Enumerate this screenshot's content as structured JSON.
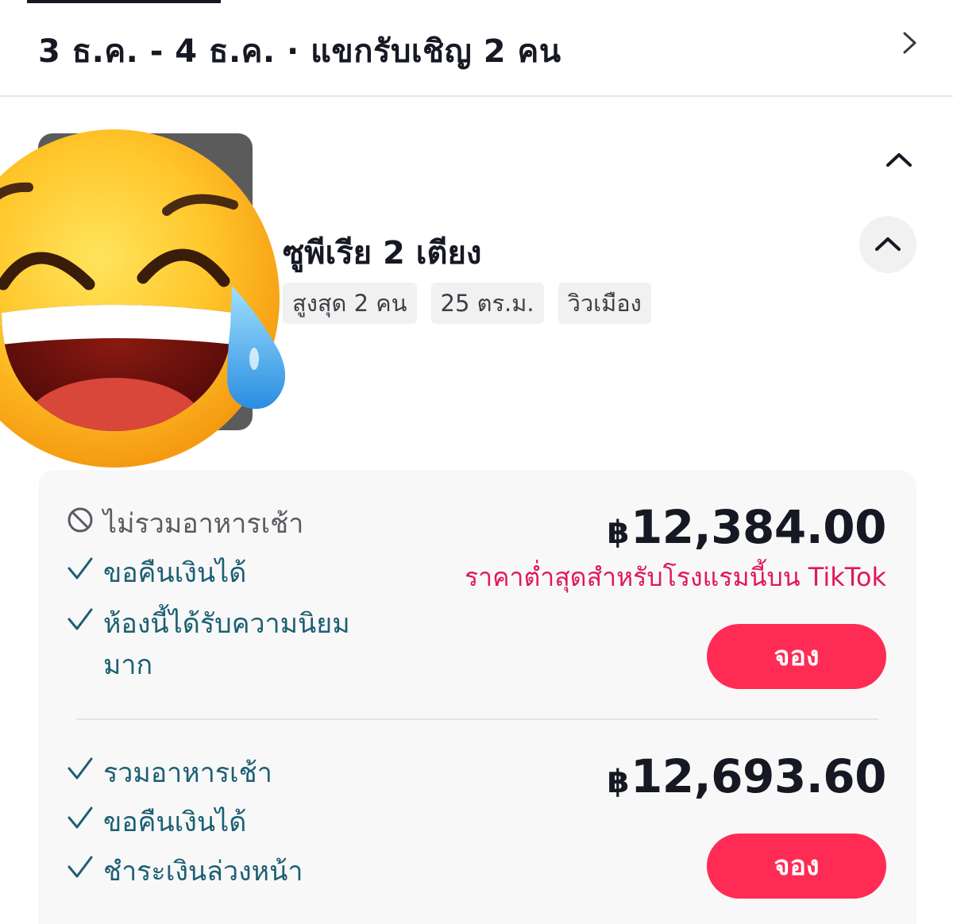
{
  "header": {
    "date_range": "3 ธ.ค.  -  4 ธ.ค.  ·  แขกรับเชิญ 2 คน"
  },
  "room": {
    "name": "ซูพีเรีย 2 เตียง",
    "tags": [
      "สูงสุด 2 คน",
      "25 ตร.ม.",
      "วิวเมือง"
    ]
  },
  "rates": [
    {
      "features": [
        {
          "icon": "no-entry-icon",
          "text": "ไม่รวมอาหารเช้า"
        },
        {
          "icon": "check-icon",
          "text": "ขอคืนเงินได้"
        },
        {
          "icon": "check-icon",
          "text": "ห้องนี้ได้รับความนิยม"
        },
        {
          "icon": "",
          "text": "มาก"
        }
      ],
      "currency": "฿",
      "price": "12,384.00",
      "note": "ราคาต่ำสุดสำหรับโรงแรมนี้บน TikTok",
      "book_label": "จอง"
    },
    {
      "features": [
        {
          "icon": "check-icon",
          "text": "รวมอาหารเช้า"
        },
        {
          "icon": "check-icon",
          "text": "ขอคืนเงินได้"
        },
        {
          "icon": "check-icon",
          "text": "ชำระเงินล่วงหน้า"
        }
      ],
      "currency": "฿",
      "price": "12,693.60",
      "book_label": "จอง"
    }
  ],
  "overlay": {
    "icon": "laughing-tears-emoji-icon"
  },
  "colors": {
    "accent": "#fe2c55",
    "note": "#e0195a",
    "feature": "#1c5f73"
  }
}
